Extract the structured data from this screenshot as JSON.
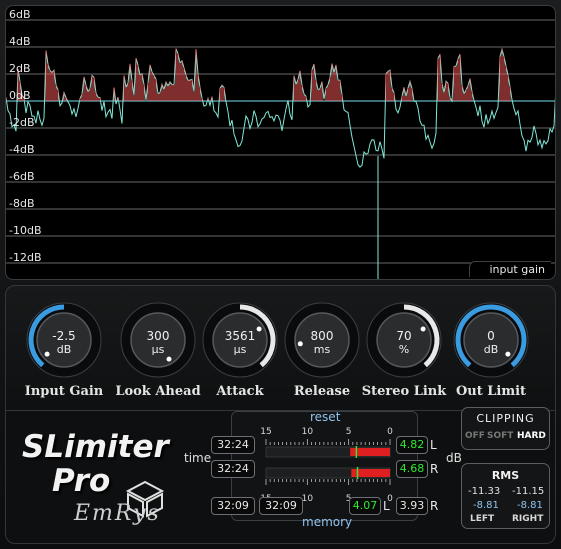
{
  "scope": {
    "db_labels": [
      "6dB",
      "4dB",
      "2dB",
      "0dB",
      "-2dB",
      "-4dB",
      "-6dB",
      "-8dB",
      "-10dB",
      "-12dB"
    ],
    "caption": "input gain",
    "colors": {
      "waveform": "#7fe8d8",
      "clipped": "#ff5a5a",
      "zero_line": "#5fb0c0",
      "grid": "#8a8a8a"
    }
  },
  "knobs": [
    {
      "value": "-2.5",
      "unit": "dB",
      "label": "Input Gain"
    },
    {
      "value": "300",
      "unit": "µs",
      "label": "Look Ahead"
    },
    {
      "value": "3561",
      "unit": "µs",
      "label": "Attack"
    },
    {
      "value": "800",
      "unit": "ms",
      "label": "Release"
    },
    {
      "value": "70",
      "unit": "%",
      "label": "Stereo Link"
    },
    {
      "value": "0",
      "unit": "dB",
      "label": "Out Limit"
    }
  ],
  "logo": {
    "line1": "SLimiter",
    "line2": "Pro",
    "signature": "EmRys"
  },
  "meters": {
    "reset_label": "reset",
    "memory_label": "memory",
    "time_label": "time",
    "db_label": "dB",
    "scale": [
      "15",
      "10",
      "5",
      "0"
    ],
    "rows": [
      {
        "time": "32:24",
        "value": "4.82",
        "channel": "L"
      },
      {
        "time": "32:24",
        "value": "4.68",
        "channel": "R"
      }
    ],
    "memory": {
      "time_1": "32:09",
      "time_2": "32:09",
      "value_l": "4.07",
      "channel_l": "L",
      "value_r": "3.93",
      "channel_r": "R"
    }
  },
  "clipping": {
    "title": "CLIPPING",
    "options": [
      "OFF",
      "SOFT",
      "HARD"
    ],
    "selected": "HARD"
  },
  "rms": {
    "title": "RMS",
    "left_top": "-11.33",
    "right_top": "-11.15",
    "left_bottom": "-8.81",
    "right_bottom": "-8.81",
    "left_label": "LEFT",
    "right_label": "RIGHT"
  }
}
